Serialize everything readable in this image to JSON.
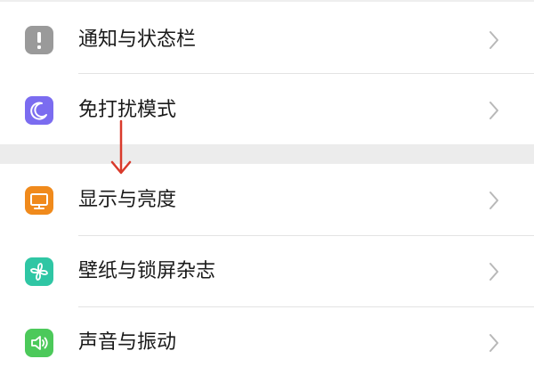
{
  "settings": {
    "items": [
      {
        "label": "通知与状态栏",
        "icon": "exclamation-icon",
        "icon_color": "#9a9a9a"
      },
      {
        "label": "免打扰模式",
        "icon": "moon-icon",
        "icon_color": "#7b6cf0"
      },
      {
        "label": "显示与亮度",
        "icon": "monitor-icon",
        "icon_color": "#f08a1c"
      },
      {
        "label": "壁纸与锁屏杂志",
        "icon": "pinwheel-icon",
        "icon_color": "#2fc6a4"
      },
      {
        "label": "声音与振动",
        "icon": "speaker-icon",
        "icon_color": "#4cc95a"
      }
    ]
  },
  "colors": {
    "arrow": "#d93a2b",
    "chevron": "#b8b8b8",
    "section_gap": "#ececec"
  }
}
